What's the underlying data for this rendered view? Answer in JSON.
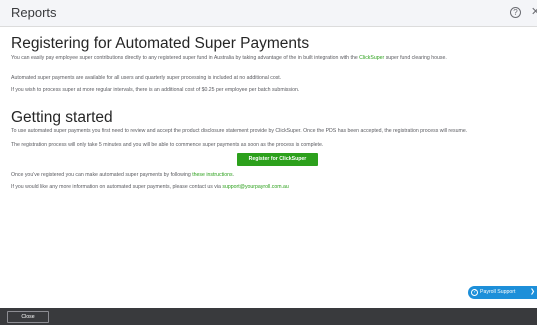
{
  "header": {
    "title": "Reports",
    "help_icon": "question-circle-icon",
    "close_icon": "close-icon",
    "help_glyph": "?",
    "close_glyph": "✕"
  },
  "main": {
    "heading": "Registering for Automated Super Payments",
    "intro_text_1": "You can easily pay employee super contributions directly to any registered super fund in Australia by taking advantage of the in built integration with the ",
    "intro_link": "ClickSuper",
    "intro_text_2": " super fund clearing house.",
    "paragraph_2": "Automated super payments are available for all users and quarterly super processing is included at no additional cost.",
    "paragraph_3": "If you wish to process super at more regular intervals, there is an additional cost of $0.25 per employee per batch submission.",
    "subheading": "Getting started",
    "paragraph_4": "To use automated super payments you first need to review and accept the product disclosure statement provide by ClickSuper. Once the PDS has been accepted, the registration process will resume.",
    "paragraph_5": "The registration process will only take 5 minutes and you will be able to commence super payments as soon as the process is complete.",
    "register_button": "Register for ClickSuper",
    "paragraph_6_text": "Once you've registered you can make automated super payments by following ",
    "paragraph_6_link": "these instructions",
    "paragraph_6_end": ".",
    "paragraph_7_text": "If you would like any more information on automated super payments, please contact us via ",
    "paragraph_7_link": "support@yourpayroll.com.au"
  },
  "support_button": {
    "label": "Payroll Support",
    "icon": "question-circle-icon",
    "icon_glyph": "?",
    "chevron_glyph": "❯"
  },
  "footer": {
    "close_button": "Close"
  },
  "colors": {
    "accent_green": "#2ca01c",
    "support_blue": "#1d8fd9",
    "footer_dark": "#393a3d"
  }
}
